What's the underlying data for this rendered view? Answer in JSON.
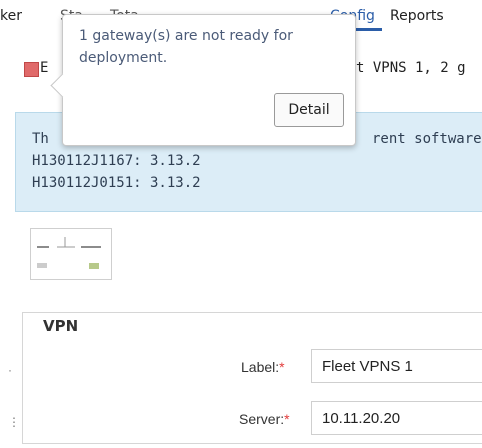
{
  "nav": {
    "tracker": "ker",
    "status": "Sta",
    "total": "Tota",
    "config": "Config",
    "reports": "Reports"
  },
  "summary": {
    "prefix": "E",
    "suffix": "t VPNS 1, 2 g",
    "error_icon": "error-square-icon"
  },
  "info": {
    "line1_prefix": "Th",
    "line1_suffix": "rent software",
    "line2": "H130112J1167: 3.13.2",
    "line3": "H130112J0151: 3.13.2"
  },
  "popup": {
    "message": "1 gateway(s) are not ready for deployment.",
    "detail_label": "Detail"
  },
  "vpn": {
    "title": "VPN",
    "label_label": "Label:",
    "label_value": "Fleet VPNS 1",
    "server_label": "Server:",
    "server_value": "10.11.20.20",
    "required_mark": "*"
  },
  "colors": {
    "accent": "#2b5da8",
    "info_bg": "#dcedf7",
    "required": "#e23c3c",
    "error": "#e06a6a"
  }
}
